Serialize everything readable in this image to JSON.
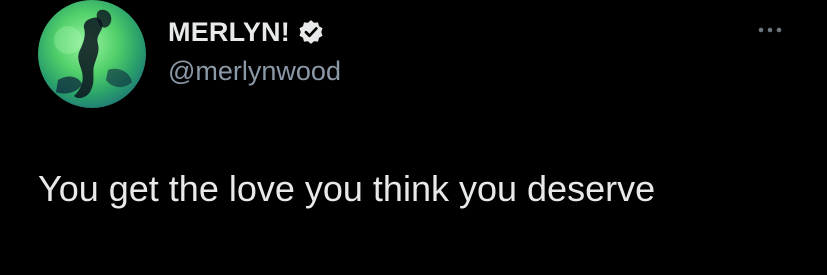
{
  "tweet": {
    "author": {
      "display_name": "MERLYN!",
      "handle": "@merlynwood",
      "verified": true,
      "avatar_icon": "profile-photo"
    },
    "text": "You get the love you think you deserve",
    "menu_icon": "more-horizontal-icon"
  },
  "colors": {
    "background": "#000000",
    "primary_text": "#e7e9ea",
    "secondary_text": "#8b98a5"
  }
}
